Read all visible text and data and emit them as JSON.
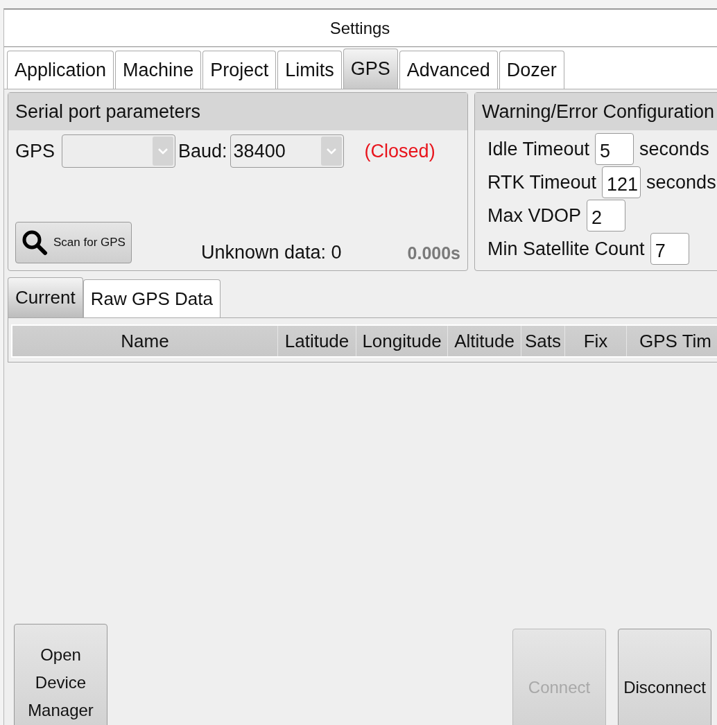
{
  "window": {
    "title": "Settings"
  },
  "tabs": [
    {
      "label": "Application",
      "selected": false
    },
    {
      "label": "Machine",
      "selected": false
    },
    {
      "label": "Project",
      "selected": false
    },
    {
      "label": "Limits",
      "selected": false
    },
    {
      "label": "GPS",
      "selected": true
    },
    {
      "label": "Advanced",
      "selected": false
    },
    {
      "label": "Dozer",
      "selected": false
    }
  ],
  "serial_panel": {
    "title": "Serial port parameters",
    "gps_label": "GPS",
    "baud_label": "Baud:",
    "baud_value": "38400",
    "status": "(Closed)",
    "scan_button": "Scan for GPS",
    "unknown_data": "Unknown data: 0",
    "elapsed": "0.000s"
  },
  "warning_panel": {
    "title": "Warning/Error Configuration",
    "rows": [
      {
        "label": "Idle Timeout",
        "value": "5",
        "unit": "seconds"
      },
      {
        "label": "RTK Timeout",
        "value": "121",
        "unit": "seconds"
      },
      {
        "label": "Max VDOP",
        "value": "2"
      },
      {
        "label": "Min Satellite Count",
        "value": "7"
      }
    ]
  },
  "subtabs": [
    {
      "label": "Current",
      "selected": true
    },
    {
      "label": "Raw GPS Data",
      "selected": false
    }
  ],
  "table": {
    "columns": [
      "Name",
      "Latitude",
      "Longitude",
      "Altitude",
      "Sats",
      "Fix",
      "GPS Tim"
    ]
  },
  "buttons": [
    {
      "label": "Open Device Manager",
      "disabled": false,
      "kind": "left"
    },
    {
      "label": "Connect",
      "disabled": true,
      "kind": "right"
    },
    {
      "label": "Disconnect",
      "disabled": false,
      "kind": "right"
    }
  ]
}
